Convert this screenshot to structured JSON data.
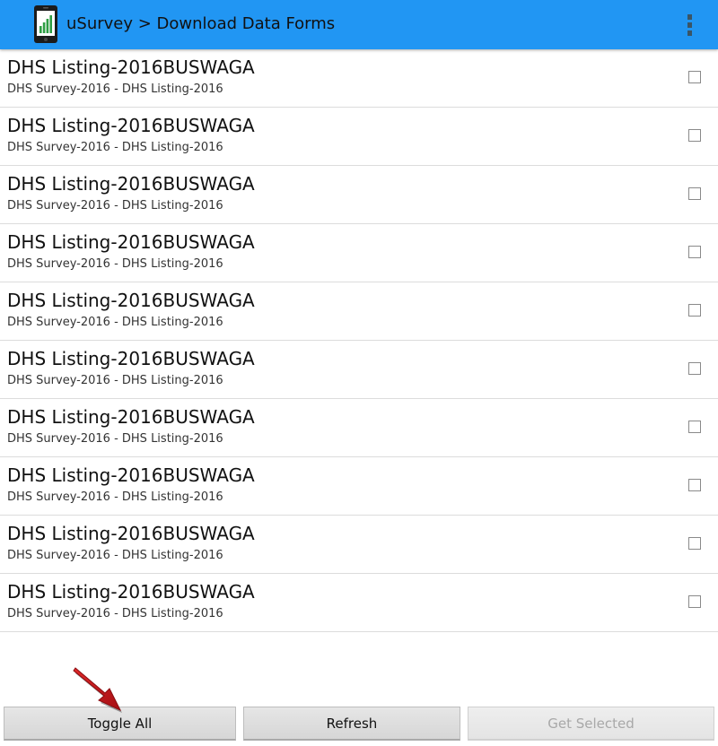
{
  "action_bar": {
    "title": "uSurvey > Download Data Forms",
    "app_icon": "phone-chart-icon",
    "menu_icon": "overflow-menu-icon",
    "color": "#2196f3"
  },
  "forms": [
    {
      "title": "DHS Listing-2016BUSWAGA",
      "subtitle": "DHS Survey-2016 - DHS Listing-2016",
      "checked": false
    },
    {
      "title": "DHS Listing-2016BUSWAGA",
      "subtitle": "DHS Survey-2016 - DHS Listing-2016",
      "checked": false
    },
    {
      "title": "DHS Listing-2016BUSWAGA",
      "subtitle": "DHS Survey-2016 - DHS Listing-2016",
      "checked": false
    },
    {
      "title": "DHS Listing-2016BUSWAGA",
      "subtitle": "DHS Survey-2016 - DHS Listing-2016",
      "checked": false
    },
    {
      "title": "DHS Listing-2016BUSWAGA",
      "subtitle": "DHS Survey-2016 - DHS Listing-2016",
      "checked": false
    },
    {
      "title": "DHS Listing-2016BUSWAGA",
      "subtitle": "DHS Survey-2016 - DHS Listing-2016",
      "checked": false
    },
    {
      "title": "DHS Listing-2016BUSWAGA",
      "subtitle": "DHS Survey-2016 - DHS Listing-2016",
      "checked": false
    },
    {
      "title": "DHS Listing-2016BUSWAGA",
      "subtitle": "DHS Survey-2016 - DHS Listing-2016",
      "checked": false
    },
    {
      "title": "DHS Listing-2016BUSWAGA",
      "subtitle": "DHS Survey-2016 - DHS Listing-2016",
      "checked": false
    },
    {
      "title": "DHS Listing-2016BUSWAGA",
      "subtitle": "DHS Survey-2016 - DHS Listing-2016",
      "checked": false
    }
  ],
  "buttons": {
    "toggle_all": "Toggle All",
    "refresh": "Refresh",
    "get_selected": "Get Selected",
    "get_selected_enabled": false
  },
  "annotation": {
    "icon": "red-arrow-pointer-icon",
    "color": "#c8141c"
  }
}
